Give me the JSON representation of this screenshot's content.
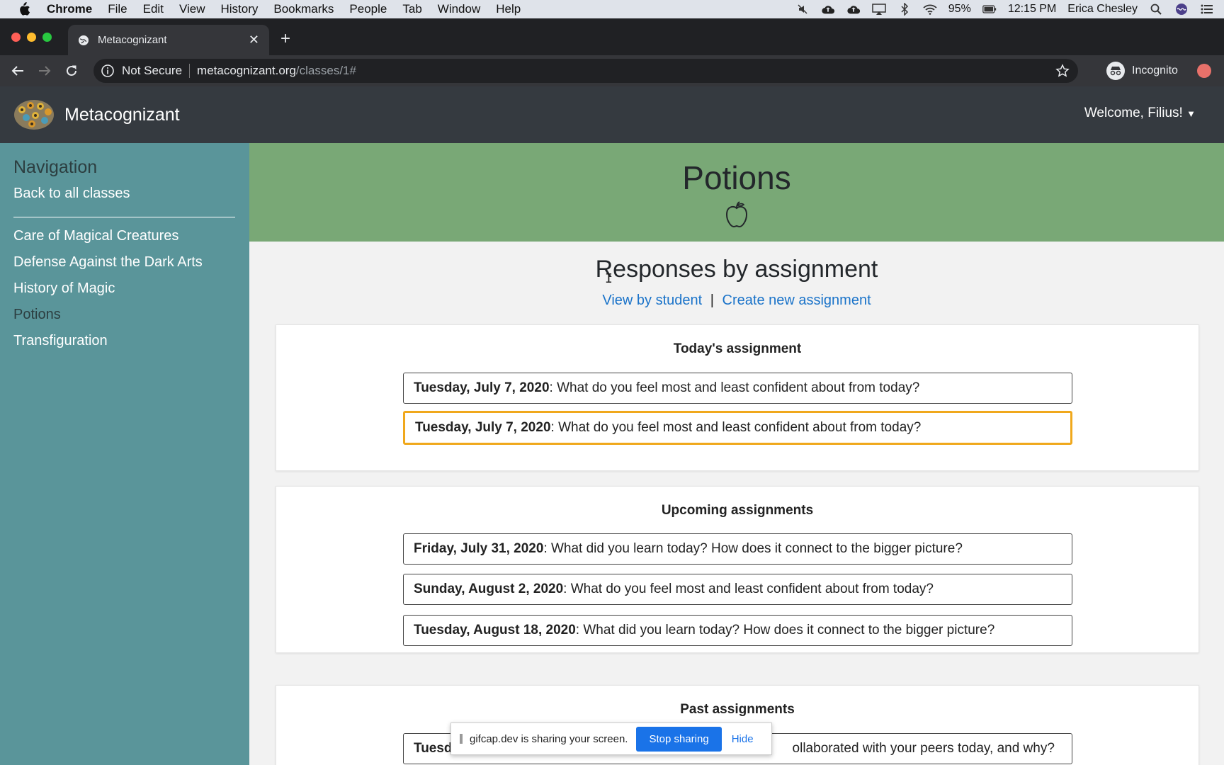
{
  "menubar": {
    "app": "Chrome",
    "items": [
      "File",
      "Edit",
      "View",
      "History",
      "Bookmarks",
      "People",
      "Tab",
      "Window",
      "Help"
    ],
    "battery": "95%",
    "time": "12:15 PM",
    "user": "Erica Chesley"
  },
  "tab": {
    "title": "Metacognizant"
  },
  "toolbar": {
    "security": "Not Secure",
    "url_host": "metacognizant.org",
    "url_path": "/classes/1#",
    "profile": "Incognito"
  },
  "site": {
    "brand": "Metacognizant",
    "welcome": "Welcome, Filius!"
  },
  "sidebar": {
    "heading": "Navigation",
    "back": "Back to all classes",
    "classes": [
      "Care of Magical Creatures",
      "Defense Against the Dark Arts",
      "History of Magic",
      "Potions",
      "Transfiguration"
    ],
    "active": "Potions"
  },
  "hero": {
    "title": "Potions"
  },
  "main": {
    "heading": "Responses by assignment",
    "link_by_student": "View by student",
    "link_separator": "|",
    "link_create": "Create new assignment"
  },
  "sections": {
    "today": {
      "heading": "Today's assignment",
      "items": [
        {
          "date": "Tuesday, July 7, 2020",
          "prompt": ": What do you feel most and least confident about from today?"
        },
        {
          "date": "Tuesday, July 7, 2020",
          "prompt": ": What do you feel most and least confident about from today?"
        }
      ]
    },
    "upcoming": {
      "heading": "Upcoming assignments",
      "items": [
        {
          "date": "Friday, July 31, 2020",
          "prompt": ": What did you learn today? How does it connect to the bigger picture?"
        },
        {
          "date": "Sunday, August 2, 2020",
          "prompt": ": What do you feel most and least confident about from today?"
        },
        {
          "date": "Tuesday, August 18, 2020",
          "prompt": ": What did you learn today? How does it connect to the bigger picture?"
        }
      ]
    },
    "past": {
      "heading": "Past assignments",
      "items": [
        {
          "date": "Tuesd",
          "prompt": "ollaborated with your peers today, and why?"
        }
      ]
    }
  },
  "share_bar": {
    "message": "gifcap.dev is sharing your screen.",
    "stop": "Stop sharing",
    "hide": "Hide"
  },
  "colors": {
    "sidebar": "#5a959a",
    "hero": "#79a876",
    "navbar": "#353a40",
    "link": "#1a73c9",
    "highlight_border": "#f0a81c"
  }
}
